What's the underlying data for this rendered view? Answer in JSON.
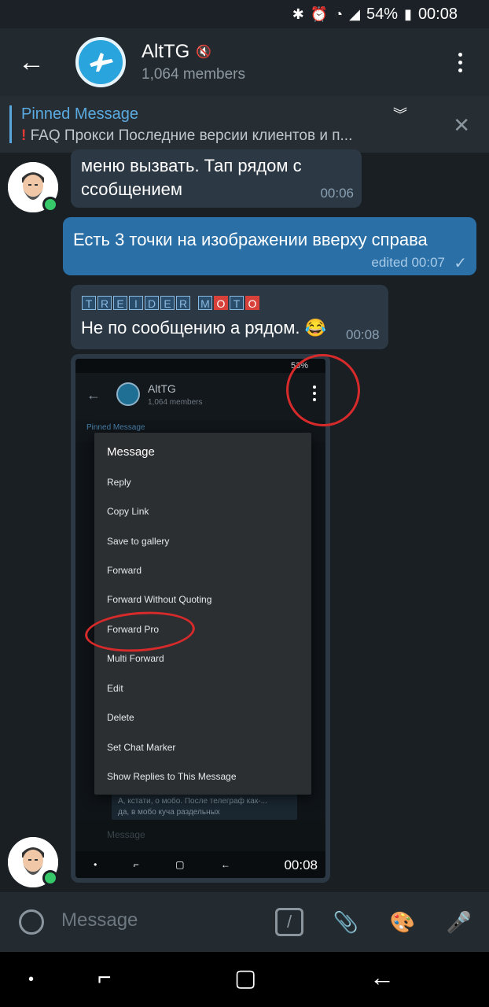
{
  "status": {
    "battery": "54%",
    "time": "00:08"
  },
  "header": {
    "title": "AltTG",
    "members": "1,064 members"
  },
  "pinned": {
    "label": "Pinned Message",
    "faq": "FAQ",
    "text": "Прокси   Последние версии клиентов и п..."
  },
  "messages": [
    {
      "text_line1": "меню вызвать. Тап рядом с",
      "text_line2": "ссобщением",
      "time": "00:06"
    },
    {
      "text": "Есть 3 точки на изображении вверху справа",
      "time": "edited 00:07"
    },
    {
      "sender_letters": [
        "T",
        "R",
        "E",
        "I",
        "D",
        "E",
        "R"
      ],
      "sender_letters2": [
        "M",
        "O",
        "T",
        "O"
      ],
      "text": "Не по сообщению а рядом. 😂",
      "time": "00:08"
    }
  ],
  "screenshot": {
    "status": "53%",
    "title": "AltTG",
    "members": "1,064 members",
    "pinned": "Pinned Message",
    "menu_title": "Message",
    "menu_items": [
      "Reply",
      "Copy Link",
      "Save to gallery",
      "Forward",
      "Forward Without Quoting",
      "Forward Pro",
      "Multi Forward",
      "Edit",
      "Delete",
      "Set Chat Marker",
      "Show Replies to This Message"
    ],
    "reply_line1": "А, кстати, о мобо. После телеграф как-...",
    "reply_line2": "да, в мобо куча раздельных",
    "input_placeholder": "Message",
    "time": "00:08"
  },
  "input": {
    "placeholder": "Message"
  }
}
